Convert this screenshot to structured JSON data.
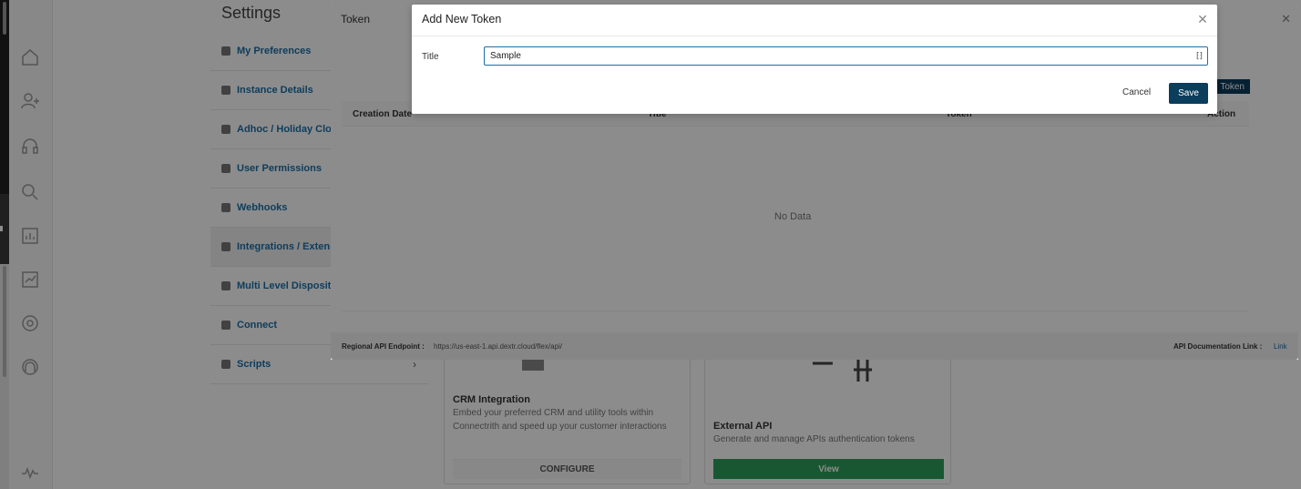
{
  "settings": {
    "title": "Settings",
    "nav": [
      {
        "label": "My Preferences"
      },
      {
        "label": "Instance Details"
      },
      {
        "label": "Adhoc / Holiday Clo"
      },
      {
        "label": "User Permissions"
      },
      {
        "label": "Webhooks"
      },
      {
        "label": "Integrations / Extens"
      },
      {
        "label": "Multi Level Dispositi"
      },
      {
        "label": "Connect"
      },
      {
        "label": "Scripts"
      }
    ]
  },
  "cards": {
    "crm": {
      "title": "CRM Integration",
      "desc": "Embed your preferred CRM and utility tools within Connectrith and speed up your customer interactions",
      "button": "CONFIGURE"
    },
    "api": {
      "title": "External API",
      "desc": "Generate and manage APIs authentication tokens",
      "button": "View"
    }
  },
  "token_panel": {
    "title": "Token",
    "add_button": "Token",
    "columns": [
      "Creation Date",
      "Title",
      "Token",
      "Action"
    ],
    "empty_text": "No Data",
    "footer": {
      "endpoint_label": "Regional API Endpoint :",
      "endpoint_value": "https://us-east-1.api.dextr.cloud/flex/api/",
      "doc_label": "API Documentation Link :",
      "doc_link": "Link"
    }
  },
  "dialog": {
    "title": "Add New Token",
    "field_label": "Title",
    "field_value": "Sample",
    "cancel": "Cancel",
    "save": "Save"
  },
  "colors": {
    "primary": "#0b3d5c",
    "link": "#1a6fa8",
    "view_green": "#2e9e5b"
  }
}
